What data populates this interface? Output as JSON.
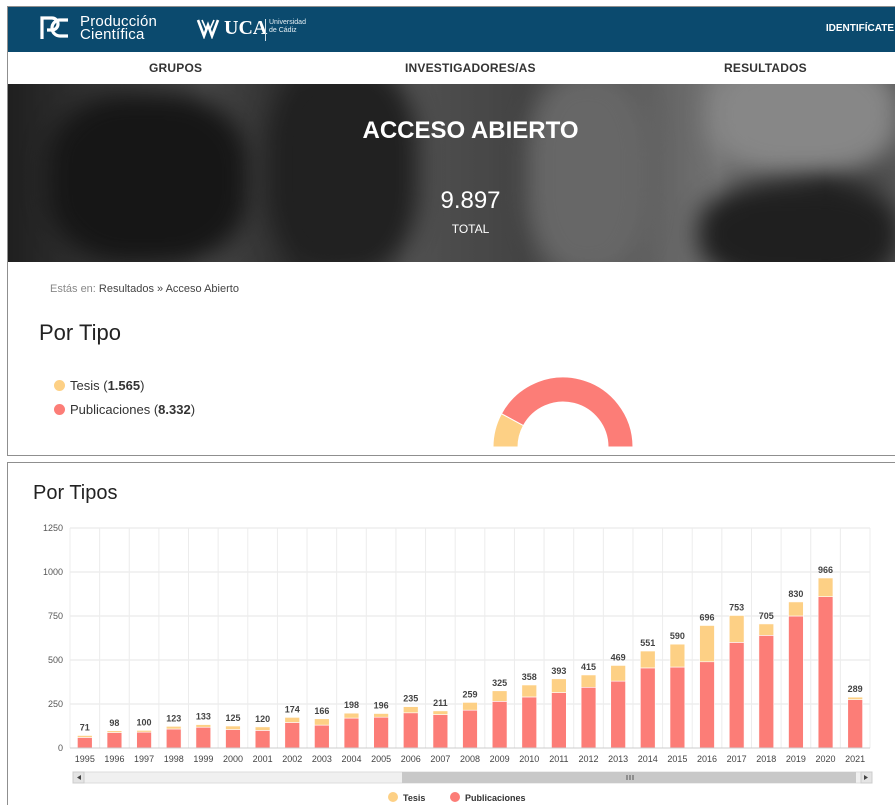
{
  "header": {
    "logo_line1": "Producción",
    "logo_line2": "Científica",
    "uca_label": "UCA",
    "uca_sub_line1": "Universidad",
    "uca_sub_line2": "de Cádiz",
    "identify_label": "IDENTIFÍCATE",
    "brand_color": "#0b4a6e"
  },
  "nav": {
    "items": [
      "GRUPOS",
      "INVESTIGADORES/AS",
      "RESULTADOS"
    ]
  },
  "hero": {
    "title": "ACCESO ABIERTO",
    "total": "9.897",
    "total_label": "TOTAL"
  },
  "breadcrumb": {
    "prefix": "Estás en:",
    "path": "Resultados » Acceso Abierto"
  },
  "por_tipo": {
    "heading": "Por Tipo",
    "items": [
      {
        "label": "Tesis",
        "value": "1.565",
        "color": "#fdd085"
      },
      {
        "label": "Publicaciones",
        "value": "8.332",
        "color": "#fc7d77"
      }
    ]
  },
  "por_tipos": {
    "heading": "Por Tipos"
  },
  "chart_data": [
    {
      "type": "pie",
      "variant": "semi-donut",
      "slices": [
        {
          "name": "Tesis",
          "value": 1565,
          "color": "#fdd085"
        },
        {
          "name": "Publicaciones",
          "value": 8332,
          "color": "#fc7d77"
        }
      ]
    },
    {
      "type": "bar",
      "stacked": true,
      "categories": [
        "1995",
        "1996",
        "1997",
        "1998",
        "1999",
        "2000",
        "2001",
        "2002",
        "2003",
        "2004",
        "2005",
        "2006",
        "2007",
        "2008",
        "2009",
        "2010",
        "2011",
        "2012",
        "2013",
        "2014",
        "2015",
        "2016",
        "2017",
        "2018",
        "2019",
        "2020",
        "2021"
      ],
      "totals": [
        71,
        98,
        100,
        123,
        133,
        125,
        120,
        174,
        166,
        198,
        196,
        235,
        211,
        259,
        325,
        358,
        393,
        415,
        469,
        551,
        590,
        696,
        753,
        705,
        830,
        966,
        289
      ],
      "series": [
        {
          "name": "Publicaciones",
          "color": "#fc7d77",
          "values": [
            60,
            88,
            90,
            108,
            118,
            105,
            100,
            145,
            130,
            170,
            175,
            200,
            190,
            215,
            265,
            290,
            315,
            345,
            380,
            455,
            460,
            490,
            600,
            640,
            750,
            860,
            275
          ]
        },
        {
          "name": "Tesis",
          "color": "#fdd085",
          "values": [
            11,
            10,
            10,
            15,
            15,
            20,
            20,
            29,
            36,
            28,
            21,
            35,
            21,
            44,
            60,
            68,
            78,
            70,
            89,
            96,
            130,
            206,
            153,
            65,
            80,
            106,
            14
          ]
        }
      ],
      "ylim": [
        0,
        1250
      ],
      "yticks": [
        "0",
        "250",
        "500",
        "750",
        "1000",
        "1250"
      ],
      "legend": [
        "Tesis",
        "Publicaciones"
      ],
      "legend_position": "bottom-center",
      "grid": true
    }
  ]
}
